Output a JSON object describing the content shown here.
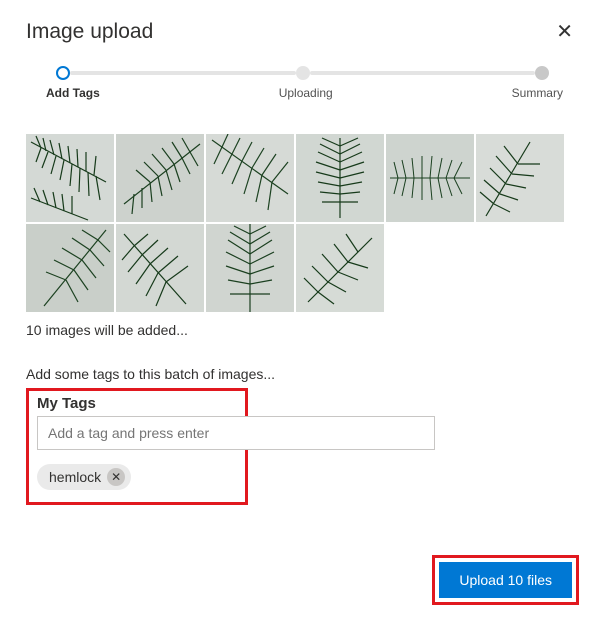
{
  "header": {
    "title": "Image upload"
  },
  "progress": {
    "steps": [
      "Add Tags",
      "Uploading",
      "Summary"
    ],
    "active_index": 0
  },
  "thumbnails": {
    "count": 10,
    "status_text": "10 images will be added..."
  },
  "tags": {
    "instruction": "Add some tags to this batch of images...",
    "section_title": "My Tags",
    "input_placeholder": "Add a tag and press enter",
    "chips": [
      "hemlock"
    ]
  },
  "actions": {
    "upload_label": "Upload 10 files"
  },
  "colors": {
    "accent": "#0078d4",
    "highlight_border": "#e1181f"
  }
}
